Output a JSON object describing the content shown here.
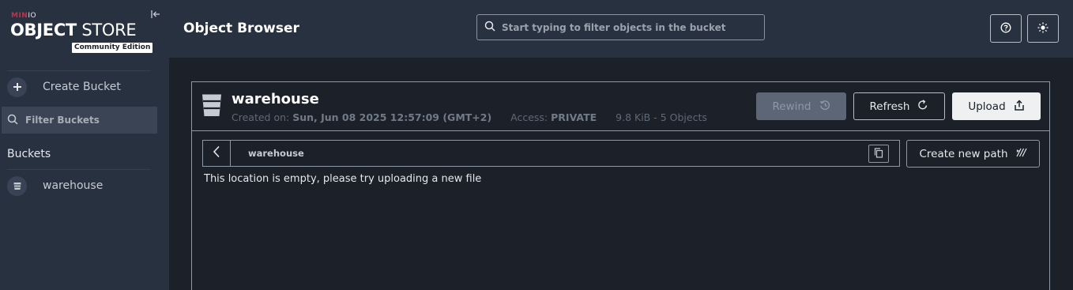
{
  "sidebar": {
    "logo": {
      "brand_left": "MIN",
      "brand_right": "IO",
      "title_bold": "OBJECT",
      "title_regular": " STORE",
      "edition": "Community Edition"
    },
    "create_bucket_label": "Create Bucket",
    "filter_placeholder": "Filter Buckets",
    "buckets_heading": "Buckets",
    "bucket_items": [
      {
        "label": "warehouse"
      }
    ]
  },
  "header": {
    "title": "Object Browser",
    "search_placeholder": "Start typing to filter objects in the bucket"
  },
  "bucket": {
    "name": "warehouse",
    "created_label": "Created on:",
    "created_value": "Sun, Jun 08 2025 12:57:09 (GMT+2)",
    "access_label": "Access:",
    "access_value": "PRIVATE",
    "size_summary": "9.8 KiB - 5 Objects"
  },
  "actions": {
    "rewind_label": "Rewind",
    "refresh_label": "Refresh",
    "upload_label": "Upload",
    "create_path_label": "Create new path"
  },
  "breadcrumb": {
    "path": "warehouse"
  },
  "empty_message": "This location is empty, please try uploading a new file",
  "colors": {
    "sidebar_bg": "#283140",
    "main_bg": "#1b2029",
    "brand": "#c72e49"
  }
}
